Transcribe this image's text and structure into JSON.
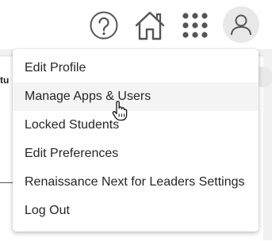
{
  "background": {
    "partial_text": "tu"
  },
  "header": {
    "icons": [
      "help-icon",
      "home-icon",
      "apps-grid-icon",
      "user-avatar-icon"
    ]
  },
  "menu": {
    "items": [
      {
        "label": "Edit Profile"
      },
      {
        "label": "Manage Apps & Users"
      },
      {
        "label": "Locked Students"
      },
      {
        "label": "Edit Preferences"
      },
      {
        "label": "Renaissance Next for Leaders Settings"
      },
      {
        "label": "Log Out"
      }
    ],
    "hovered_item": "Manage Apps & Users"
  },
  "colors": {
    "icon": "#555555",
    "hover_bg": "#f4f4f4",
    "text": "#262626"
  }
}
